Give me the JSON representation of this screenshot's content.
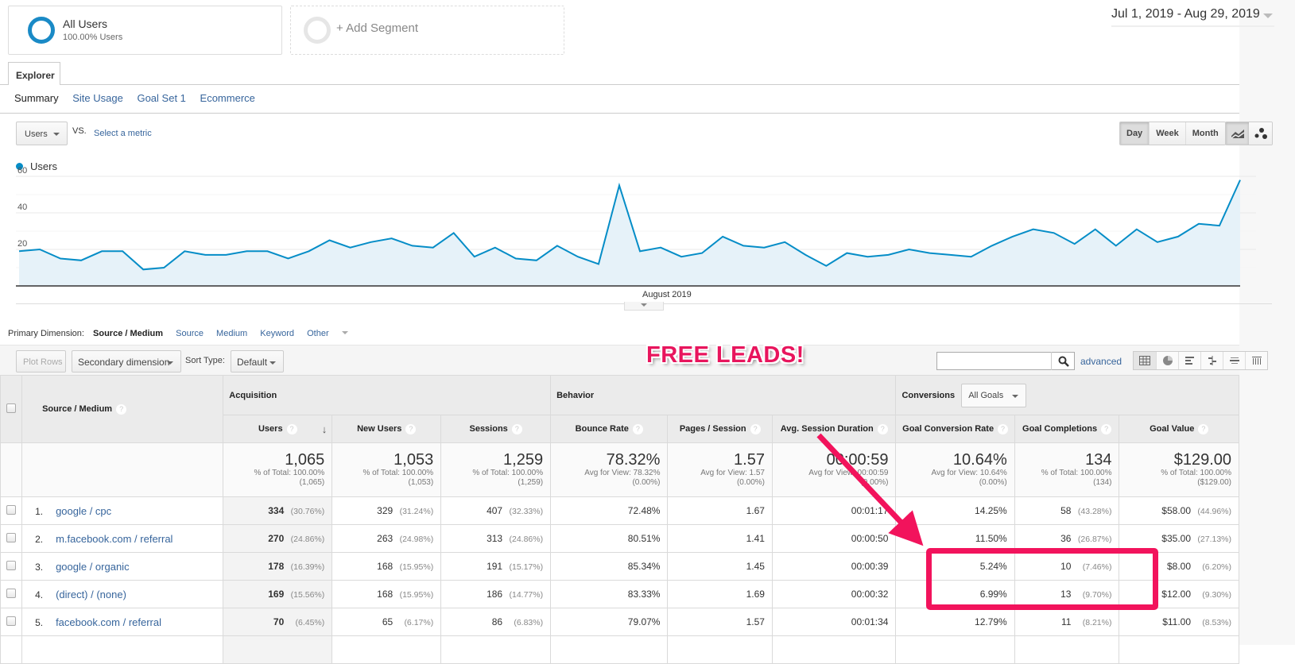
{
  "segments": {
    "active": {
      "title": "All Users",
      "subtitle": "100.00% Users"
    },
    "add_label": "+ Add Segment"
  },
  "date_range": "Jul 1, 2019 - Aug 29, 2019",
  "tabs": {
    "explorer": "Explorer",
    "subtabs": [
      "Summary",
      "Site Usage",
      "Goal Set 1",
      "Ecommerce"
    ]
  },
  "metric_selector": {
    "value": "Users",
    "vs": "VS.",
    "select_metric": "Select a metric"
  },
  "period_buttons": [
    "Day",
    "Week",
    "Month"
  ],
  "period_selected": "Day",
  "legend": "Users",
  "chart_data": {
    "type": "area",
    "title": "",
    "series": [
      {
        "name": "Users",
        "color": "#058dc7",
        "values": [
          19,
          20,
          15,
          14,
          19,
          19,
          9,
          10,
          19,
          17,
          17,
          19,
          19,
          15,
          19,
          25,
          21,
          24,
          26,
          22,
          21,
          29,
          16,
          21,
          15,
          14,
          22,
          16,
          12,
          55,
          19,
          21,
          16,
          18,
          27,
          22,
          21,
          24,
          17,
          11,
          18,
          16,
          17,
          20,
          18,
          17,
          16,
          22,
          27,
          31,
          29,
          23,
          31,
          22,
          31,
          24,
          27,
          34,
          33,
          58
        ]
      }
    ],
    "x_start": "Jul 1, 2019",
    "x_end": "Aug 29, 2019",
    "x_tick_labels": [
      "August 2019"
    ],
    "y_tick_labels": [
      "20",
      "40",
      "60"
    ],
    "ylim": [
      0,
      60
    ],
    "grid": true
  },
  "primary_dimension": {
    "label": "Primary Dimension:",
    "active": "Source / Medium",
    "options": [
      "Source",
      "Medium",
      "Keyword",
      "Other"
    ]
  },
  "toolbar": {
    "plot_rows": "Plot Rows",
    "secondary_dimension": "Secondary dimension",
    "sort_type_label": "Sort Type:",
    "sort_type_value": "Default",
    "search_value": "",
    "advanced": "advanced"
  },
  "annotation": {
    "text": "FREE LEADS!",
    "color": "#e8155d"
  },
  "table": {
    "dim_header": "Source / Medium",
    "groups": {
      "acquisition": "Acquisition",
      "behavior": "Behavior",
      "conversions": "Conversions",
      "goal_select": "All Goals"
    },
    "columns": [
      "Users",
      "New Users",
      "Sessions",
      "Bounce Rate",
      "Pages / Session",
      "Avg. Session Duration",
      "Goal Conversion Rate",
      "Goal Completions",
      "Goal Value"
    ],
    "totals": [
      {
        "value": "1,065",
        "sub1": "% of Total: 100.00%",
        "sub2": "(1,065)"
      },
      {
        "value": "1,053",
        "sub1": "% of Total: 100.00%",
        "sub2": "(1,053)"
      },
      {
        "value": "1,259",
        "sub1": "% of Total: 100.00%",
        "sub2": "(1,259)"
      },
      {
        "value": "78.32%",
        "sub1": "Avg for View: 78.32%",
        "sub2": "(0.00%)"
      },
      {
        "value": "1.57",
        "sub1": "Avg for View: 1.57",
        "sub2": "(0.00%)"
      },
      {
        "value": "00:00:59",
        "sub1": "Avg for View: 00:00:59",
        "sub2": "(0.00%)"
      },
      {
        "value": "10.64%",
        "sub1": "Avg for View: 10.64%",
        "sub2": "(0.00%)"
      },
      {
        "value": "134",
        "sub1": "% of Total: 100.00%",
        "sub2": "(134)"
      },
      {
        "value": "$129.00",
        "sub1": "% of Total: 100.00%",
        "sub2": "($129.00)"
      }
    ],
    "rows": [
      {
        "idx": "1.",
        "dim": "google / cpc",
        "users": "334",
        "users_pct": "(30.76%)",
        "new_users": "329",
        "new_users_pct": "(31.24%)",
        "sessions": "407",
        "sessions_pct": "(32.33%)",
        "bounce": "72.48%",
        "pages": "1.67",
        "duration": "00:01:17",
        "conv_rate": "14.25%",
        "completions": "58",
        "completions_pct": "(43.28%)",
        "value": "$58.00",
        "value_pct": "(44.96%)"
      },
      {
        "idx": "2.",
        "dim": "m.facebook.com / referral",
        "users": "270",
        "users_pct": "(24.86%)",
        "new_users": "263",
        "new_users_pct": "(24.98%)",
        "sessions": "313",
        "sessions_pct": "(24.86%)",
        "bounce": "80.51%",
        "pages": "1.41",
        "duration": "00:00:50",
        "conv_rate": "11.50%",
        "completions": "36",
        "completions_pct": "(26.87%)",
        "value": "$35.00",
        "value_pct": "(27.13%)"
      },
      {
        "idx": "3.",
        "dim": "google / organic",
        "users": "178",
        "users_pct": "(16.39%)",
        "new_users": "168",
        "new_users_pct": "(15.95%)",
        "sessions": "191",
        "sessions_pct": "(15.17%)",
        "bounce": "85.34%",
        "pages": "1.45",
        "duration": "00:00:39",
        "conv_rate": "5.24%",
        "completions": "10",
        "completions_pct": "(7.46%)",
        "value": "$8.00",
        "value_pct": "(6.20%)"
      },
      {
        "idx": "4.",
        "dim": "(direct) / (none)",
        "users": "169",
        "users_pct": "(15.56%)",
        "new_users": "168",
        "new_users_pct": "(15.95%)",
        "sessions": "186",
        "sessions_pct": "(14.77%)",
        "bounce": "83.33%",
        "pages": "1.69",
        "duration": "00:00:32",
        "conv_rate": "6.99%",
        "completions": "13",
        "completions_pct": "(9.70%)",
        "value": "$12.00",
        "value_pct": "(9.30%)"
      },
      {
        "idx": "5.",
        "dim": "facebook.com / referral",
        "users": "70",
        "users_pct": "(6.45%)",
        "new_users": "65",
        "new_users_pct": "(6.17%)",
        "sessions": "86",
        "sessions_pct": "(6.83%)",
        "bounce": "79.07%",
        "pages": "1.57",
        "duration": "00:01:34",
        "conv_rate": "12.79%",
        "completions": "11",
        "completions_pct": "(8.21%)",
        "value": "$11.00",
        "value_pct": "(8.53%)"
      }
    ]
  }
}
